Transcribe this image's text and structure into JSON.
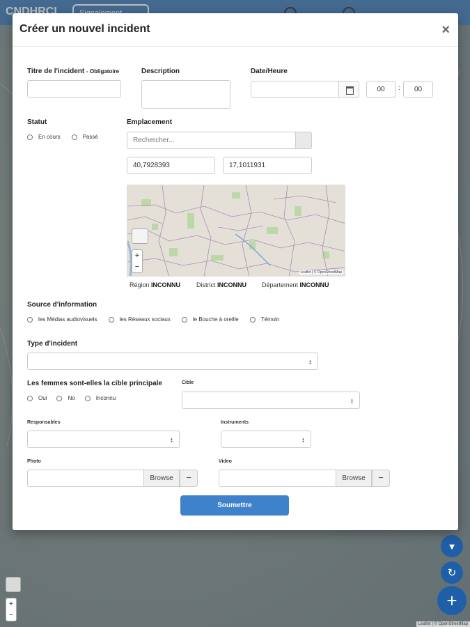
{
  "app": {
    "brand": "CNDHRCI",
    "brand_button": "Signalement"
  },
  "modal": {
    "title": "Créer un nouvel incident",
    "close": "×"
  },
  "title_field": {
    "label": "Titre de l'incident",
    "required_note": "- Obligatoire",
    "value": ""
  },
  "description_field": {
    "label": "Description",
    "value": ""
  },
  "datetime_field": {
    "label": "Date/Heure",
    "date_value": "",
    "hour": "00",
    "minute": "00",
    "separator": ":"
  },
  "status": {
    "label": "Statut",
    "options": [
      "En cours",
      "Passé"
    ]
  },
  "location": {
    "label": "Emplacement",
    "search_placeholder": "Rechercher...",
    "latitude": "40,7928393",
    "longitude": "17,1011931",
    "map_attribution": "Leaflet | © OpenStreetMap",
    "region_label": "Région",
    "region_value": "INCONNU",
    "district_label": "District",
    "district_value": "INCONNU",
    "department_label": "Département",
    "department_value": "INCONNU"
  },
  "source": {
    "label": "Source d'information",
    "options": [
      "les Médias audiovisuels",
      "les Réseaux sociaux",
      "le Bouche à oreille",
      "Témoin"
    ]
  },
  "incident_type": {
    "label": "Type d'incident",
    "value": ""
  },
  "women_target": {
    "label": "Les femmes sont-elles la cible principale",
    "options": [
      "Oui",
      "No",
      "Inconnu"
    ]
  },
  "target": {
    "label": "Cible",
    "value": ""
  },
  "responsables": {
    "label": "Responsables",
    "value": ""
  },
  "instruments": {
    "label": "Instruments",
    "value": ""
  },
  "photo": {
    "label": "Photo",
    "browse": "Browse",
    "remove": "−"
  },
  "video": {
    "label": "Video",
    "browse": "Browse",
    "remove": "−"
  },
  "submit": "Soumettre",
  "bg_attribution": "Leaflet | © OpenStreetMap",
  "colors": {
    "primary": "#3f82cc",
    "topbar": "#4a7fb5",
    "fab": "#1f5fa8"
  }
}
